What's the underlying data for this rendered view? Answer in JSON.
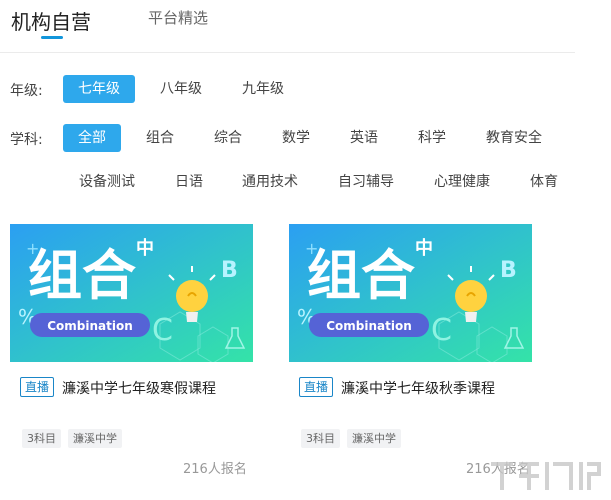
{
  "tabs": {
    "active": "机构自营",
    "other": "平台精选"
  },
  "grade": {
    "label": "年级:",
    "options": [
      "七年级",
      "八年级",
      "九年级"
    ]
  },
  "subject": {
    "label": "学科:",
    "row1": [
      "全部",
      "组合",
      "综合",
      "数学",
      "英语",
      "科学",
      "教育安全"
    ],
    "row2": [
      "设备测试",
      "日语",
      "通用技术",
      "自习辅导",
      "心理健康",
      "体育"
    ]
  },
  "banner": {
    "big_text": "组合",
    "pill_text": "Combination",
    "glyph_zhong": "中",
    "glyph_b": "B",
    "glyph_c": "C",
    "glyph_percent": "%",
    "glyph_plus": "+"
  },
  "courses": [
    {
      "badge": "直播",
      "title": "濂溪中学七年级寒假课程",
      "tags": [
        "3科目",
        "濂溪中学"
      ],
      "enroll": "216人报名"
    },
    {
      "badge": "直播",
      "title": "濂溪中学七年级秋季课程",
      "tags": [
        "3科目",
        "濂溪中学"
      ],
      "enroll": "216人报名"
    }
  ],
  "colors": {
    "accent": "#2ea8ec",
    "banner_blue": "#2b9ff2",
    "banner_green": "#34e3a8",
    "pill": "#5563d6"
  },
  "icons": [
    "lightbulb-icon",
    "flask-icon"
  ]
}
